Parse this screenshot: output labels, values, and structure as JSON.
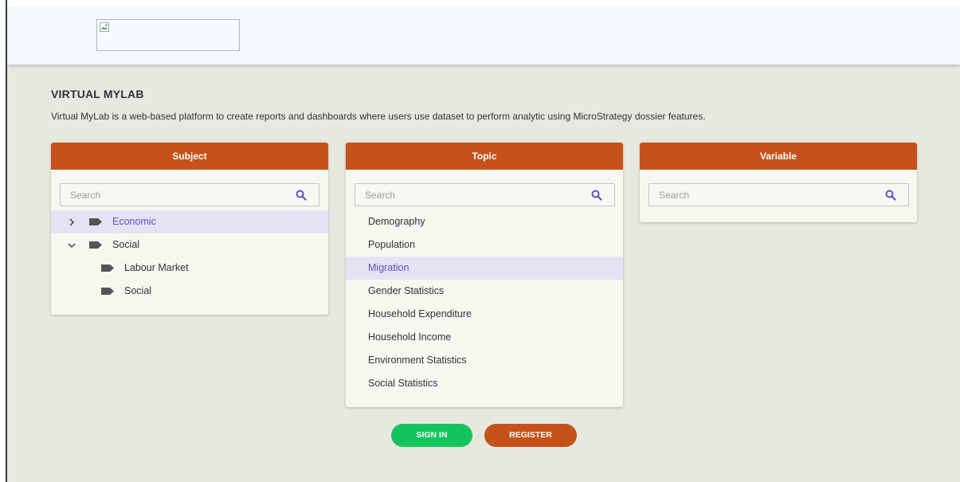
{
  "header": {
    "logo_alt": ""
  },
  "intro": {
    "title": "VIRTUAL MYLAB",
    "description": "Virtual MyLab is a web-based platform to create reports and dashboards where users use dataset to perform analytic using MicroStrategy dossier features."
  },
  "subject": {
    "title": "Subject",
    "search_placeholder": "Search",
    "items": [
      {
        "label": "Economic",
        "expanded": false,
        "selected": true
      },
      {
        "label": "Social",
        "expanded": true,
        "selected": false
      },
      {
        "label": "Labour Market",
        "child": true
      },
      {
        "label": "Social",
        "child": true
      }
    ]
  },
  "topic": {
    "title": "Topic",
    "search_placeholder": "Search",
    "items": [
      {
        "label": "Demography"
      },
      {
        "label": "Population"
      },
      {
        "label": "Migration",
        "selected": true
      },
      {
        "label": "Gender Statistics"
      },
      {
        "label": "Household Expenditure"
      },
      {
        "label": "Household Income"
      },
      {
        "label": "Environment Statistics"
      },
      {
        "label": "Social Statistics"
      }
    ]
  },
  "variable": {
    "title": "Variable",
    "search_placeholder": "Search"
  },
  "actions": {
    "sign_in": "SIGN IN",
    "register": "REGISTER"
  },
  "colors": {
    "accent": "#c4521a",
    "sign_in": "#12c45c",
    "selected_text": "#5b51c7",
    "selected_bg": "#e6e2f4",
    "background": "#e7e8e0"
  },
  "icons": {
    "search": "search-icon",
    "expand": "chevron-right-icon",
    "collapse": "chevron-down-icon",
    "category": "tag-icon"
  }
}
